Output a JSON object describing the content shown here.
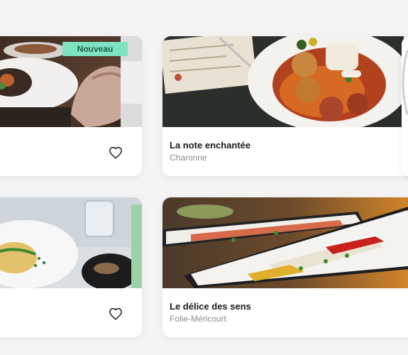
{
  "badge": {
    "label": "Nouveau"
  },
  "restaurants": [
    {
      "name": "",
      "area": "",
      "favorite_icon": "heart-icon"
    },
    {
      "name": "La note enchantée",
      "area": "Charonne"
    },
    {
      "name": "",
      "area": "",
      "favorite_icon": "heart-icon"
    },
    {
      "name": "Le délice des sens",
      "area": "Folie-Méricourt"
    }
  ],
  "colors": {
    "badge_bg": "#7fe3c2",
    "page_bg": "#f4f4f4",
    "card_bg": "#ffffff",
    "title": "#1a1a1a",
    "subtitle": "#8c8c8c"
  }
}
